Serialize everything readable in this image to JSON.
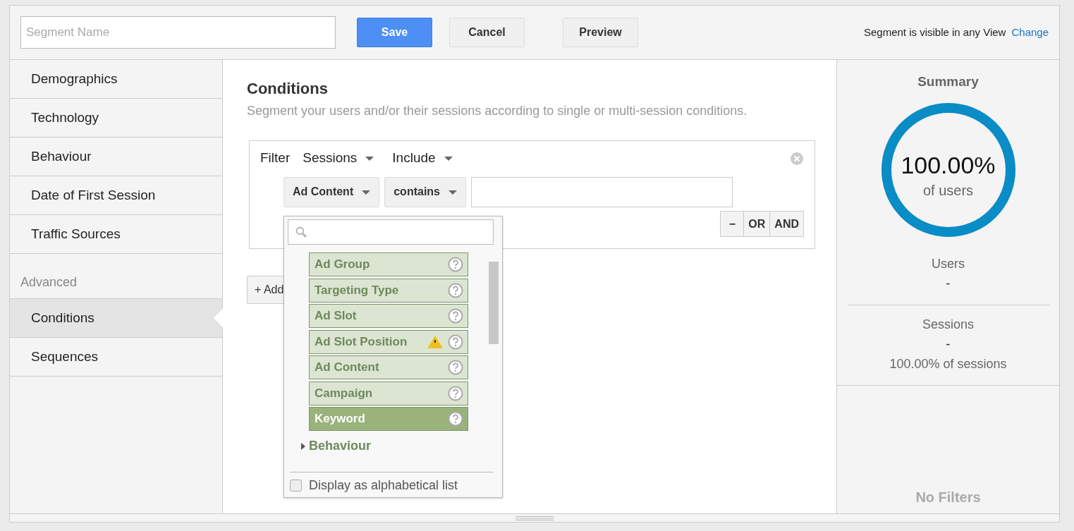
{
  "header": {
    "name_field": {
      "placeholder": "Segment Name"
    },
    "buttons": [
      {
        "label": "Save",
        "kind": "primary"
      },
      {
        "label": "Cancel",
        "kind": "default"
      },
      {
        "label": "Preview",
        "kind": "default"
      }
    ],
    "visibility": "Segment is visible in any View",
    "change_link": "Change"
  },
  "sidebar": {
    "items": [
      {
        "label": "Demographics",
        "selected": false
      },
      {
        "label": "Technology",
        "selected": false
      },
      {
        "label": "Behaviour",
        "selected": false
      },
      {
        "label": "Date of First Session",
        "selected": false
      },
      {
        "label": "Traffic Sources",
        "selected": false
      }
    ],
    "advanced_heading": "Advanced",
    "advanced_items": [
      {
        "label": "Conditions",
        "selected": true
      },
      {
        "label": "Sequences",
        "selected": false
      }
    ]
  },
  "conditions": {
    "title": "Conditions",
    "subtitle": "Segment your users and/or their sessions according to single or multi-session conditions.",
    "filter": {
      "label": "Filter",
      "scope": "Sessions",
      "mode": "Include",
      "dimension": "Ad Content",
      "operator": "contains",
      "logic_buttons": [
        "−",
        "OR",
        "AND"
      ]
    },
    "add_button": "+ Add",
    "dropdown": {
      "items": [
        {
          "label": "Ad Group",
          "selected": false,
          "warning": false
        },
        {
          "label": "Targeting Type",
          "selected": false,
          "warning": false
        },
        {
          "label": "Ad Slot",
          "selected": false,
          "warning": false
        },
        {
          "label": "Ad Slot Position",
          "selected": false,
          "warning": true
        },
        {
          "label": "Ad Content",
          "selected": false,
          "warning": false
        },
        {
          "label": "Campaign",
          "selected": false,
          "warning": false
        },
        {
          "label": "Keyword",
          "selected": true,
          "warning": false
        }
      ],
      "groups": [
        {
          "label": "Behaviour",
          "expanded": false
        }
      ],
      "alphabetical": {
        "label": "Display as alphabetical list",
        "checked": false
      }
    }
  },
  "summary": {
    "title": "Summary",
    "meter": {
      "value": "100.00%",
      "caption": "of users",
      "level": 1
    },
    "users": {
      "label": "Users",
      "value": "-"
    },
    "sessions": {
      "label": "Sessions",
      "value": "-",
      "share": "100.00% of sessions"
    },
    "filters": "No Filters"
  }
}
